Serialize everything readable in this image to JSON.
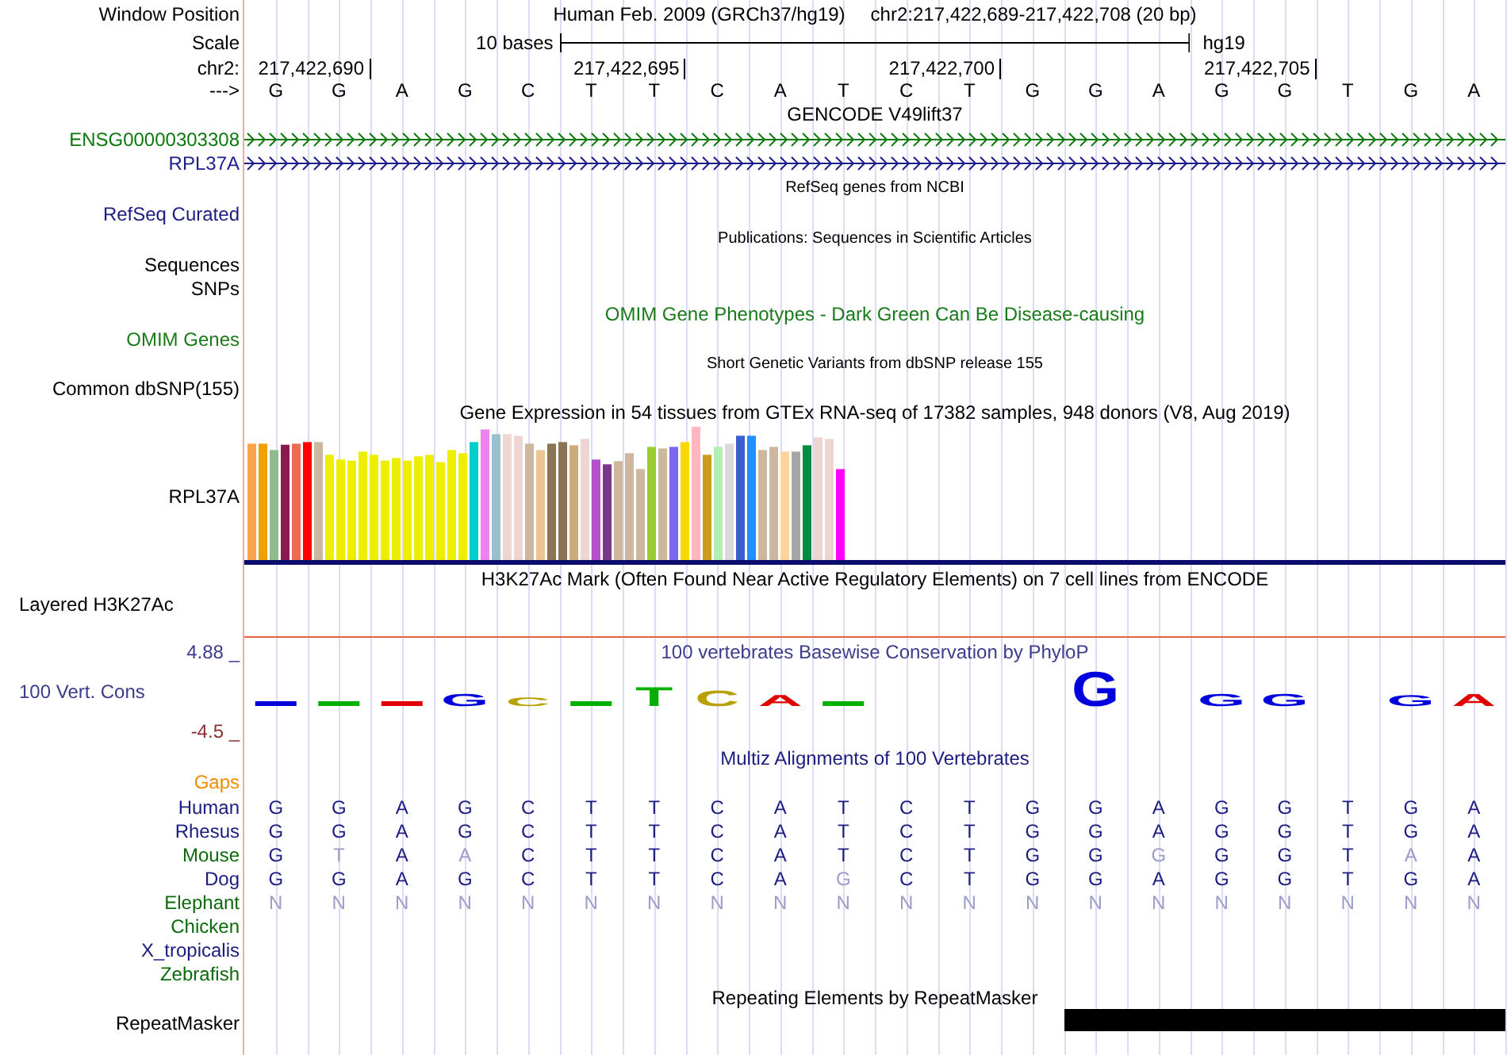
{
  "window_position": {
    "label": "Window Position",
    "assembly": "Human Feb. 2009 (GRCh37/hg19)",
    "range": "chr2:217,422,689-217,422,708 (20 bp)"
  },
  "scale": {
    "label": "Scale",
    "ruler_label": "10 bases",
    "assembly": "hg19"
  },
  "coordinates": {
    "label": "chr2:",
    "ticks": [
      "217,422,690",
      "217,422,695",
      "217,422,700",
      "217,422,705"
    ]
  },
  "sequence": {
    "label": "--->",
    "bases": [
      "G",
      "G",
      "A",
      "G",
      "C",
      "T",
      "T",
      "C",
      "A",
      "T",
      "C",
      "T",
      "G",
      "G",
      "A",
      "G",
      "G",
      "T",
      "G",
      "A"
    ]
  },
  "gencode": {
    "title": "GENCODE V49lift37",
    "genes": [
      {
        "name": "ENSG00000303308",
        "color": "#0b780b"
      },
      {
        "name": "RPL37A",
        "color": "#1c1c8c"
      }
    ]
  },
  "refseq": {
    "title": "RefSeq genes from NCBI",
    "label": "RefSeq Curated"
  },
  "publications": {
    "title": "Publications: Sequences in Scientific Articles",
    "labels": [
      "Sequences",
      "SNPs"
    ]
  },
  "omim": {
    "title": "OMIM Gene Phenotypes - Dark Green Can Be Disease-causing",
    "label": "OMIM Genes"
  },
  "dbsnp": {
    "title": "Short Genetic Variants from dbSNP release 155",
    "label": "Common dbSNP(155)"
  },
  "gtex": {
    "title": "Gene Expression in 54 tissues from GTEx RNA-seq of 17382 samples, 948 donors (V8, Aug 2019)",
    "label": "RPL37A"
  },
  "h3k27ac": {
    "title": "H3K27Ac Mark (Often Found Near Active Regulatory Elements) on 7 cell lines from ENCODE",
    "label": "Layered H3K27Ac"
  },
  "phylop": {
    "title": "100 vertebrates Basewise Conservation by PhyloP",
    "label": "100 Vert. Cons",
    "max": "4.88 _",
    "min": "-4.5 _",
    "glyphs": [
      {
        "base": "G",
        "color": "#0000dd"
      },
      {
        "base": "C",
        "color": "#b8a000"
      },
      {
        "base": "T",
        "color": "#00b000"
      },
      {
        "base": "C",
        "color": "#b8a000"
      },
      {
        "base": "A",
        "color": "#e00000"
      },
      {
        "base": "G",
        "color": "#0000dd"
      },
      {
        "base": "G",
        "color": "#0000dd"
      },
      {
        "base": "G",
        "color": "#0000dd"
      },
      {
        "base": "G",
        "color": "#0000dd"
      },
      {
        "base": "A",
        "color": "#e00000"
      }
    ]
  },
  "multiz": {
    "title": "Multiz Alignments of 100 Vertebrates",
    "gaps_label": "Gaps",
    "species": [
      {
        "name": "Human",
        "color": "#1c1c80",
        "bases": [
          {
            "base": "G",
            "faded": false
          },
          {
            "base": "G",
            "faded": false
          },
          {
            "base": "A",
            "faded": false
          },
          {
            "base": "G",
            "faded": false
          },
          {
            "base": "C",
            "faded": false
          },
          {
            "base": "T",
            "faded": false
          },
          {
            "base": "T",
            "faded": false
          },
          {
            "base": "C",
            "faded": false
          },
          {
            "base": "A",
            "faded": false
          },
          {
            "base": "T",
            "faded": false
          },
          {
            "base": "C",
            "faded": false
          },
          {
            "base": "T",
            "faded": false
          },
          {
            "base": "G",
            "faded": false
          },
          {
            "base": "G",
            "faded": false
          },
          {
            "base": "A",
            "faded": false
          },
          {
            "base": "G",
            "faded": false
          },
          {
            "base": "G",
            "faded": false
          },
          {
            "base": "T",
            "faded": false
          },
          {
            "base": "G",
            "faded": false
          },
          {
            "base": "A",
            "faded": false
          }
        ]
      },
      {
        "name": "Rhesus",
        "color": "#1c1c80",
        "bases": [
          {
            "base": "G",
            "faded": false
          },
          {
            "base": "G",
            "faded": false
          },
          {
            "base": "A",
            "faded": false
          },
          {
            "base": "G",
            "faded": false
          },
          {
            "base": "C",
            "faded": false
          },
          {
            "base": "T",
            "faded": false
          },
          {
            "base": "T",
            "faded": false
          },
          {
            "base": "C",
            "faded": false
          },
          {
            "base": "A",
            "faded": false
          },
          {
            "base": "T",
            "faded": false
          },
          {
            "base": "C",
            "faded": false
          },
          {
            "base": "T",
            "faded": false
          },
          {
            "base": "G",
            "faded": false
          },
          {
            "base": "G",
            "faded": false
          },
          {
            "base": "A",
            "faded": false
          },
          {
            "base": "G",
            "faded": false
          },
          {
            "base": "G",
            "faded": false
          },
          {
            "base": "T",
            "faded": false
          },
          {
            "base": "G",
            "faded": false
          },
          {
            "base": "A",
            "faded": false
          }
        ]
      },
      {
        "name": "Mouse",
        "color": "#0b6b0b",
        "bases": [
          {
            "base": "G",
            "faded": false
          },
          {
            "base": "T",
            "faded": true
          },
          {
            "base": "A",
            "faded": false
          },
          {
            "base": "A",
            "faded": true
          },
          {
            "base": "C",
            "faded": false
          },
          {
            "base": "T",
            "faded": false
          },
          {
            "base": "T",
            "faded": false
          },
          {
            "base": "C",
            "faded": false
          },
          {
            "base": "A",
            "faded": false
          },
          {
            "base": "T",
            "faded": false
          },
          {
            "base": "C",
            "faded": false
          },
          {
            "base": "T",
            "faded": false
          },
          {
            "base": "G",
            "faded": false
          },
          {
            "base": "G",
            "faded": false
          },
          {
            "base": "G",
            "faded": true
          },
          {
            "base": "G",
            "faded": false
          },
          {
            "base": "G",
            "faded": false
          },
          {
            "base": "T",
            "faded": false
          },
          {
            "base": "A",
            "faded": true
          },
          {
            "base": "A",
            "faded": false
          }
        ]
      },
      {
        "name": "Dog",
        "color": "#1c1c80",
        "bases": [
          {
            "base": "G",
            "faded": false
          },
          {
            "base": "G",
            "faded": false
          },
          {
            "base": "A",
            "faded": false
          },
          {
            "base": "G",
            "faded": false
          },
          {
            "base": "C",
            "faded": false
          },
          {
            "base": "T",
            "faded": false
          },
          {
            "base": "T",
            "faded": false
          },
          {
            "base": "C",
            "faded": false
          },
          {
            "base": "A",
            "faded": false
          },
          {
            "base": "G",
            "faded": true
          },
          {
            "base": "C",
            "faded": false
          },
          {
            "base": "T",
            "faded": false
          },
          {
            "base": "G",
            "faded": false
          },
          {
            "base": "G",
            "faded": false
          },
          {
            "base": "A",
            "faded": false
          },
          {
            "base": "G",
            "faded": false
          },
          {
            "base": "G",
            "faded": false
          },
          {
            "base": "T",
            "faded": false
          },
          {
            "base": "G",
            "faded": false
          },
          {
            "base": "A",
            "faded": false
          }
        ]
      },
      {
        "name": "Elephant",
        "color": "#0b6b0b",
        "bases": [
          {
            "base": "N",
            "faded": true
          },
          {
            "base": "N",
            "faded": true
          },
          {
            "base": "N",
            "faded": true
          },
          {
            "base": "N",
            "faded": true
          },
          {
            "base": "N",
            "faded": true
          },
          {
            "base": "N",
            "faded": true
          },
          {
            "base": "N",
            "faded": true
          },
          {
            "base": "N",
            "faded": true
          },
          {
            "base": "N",
            "faded": true
          },
          {
            "base": "N",
            "faded": true
          },
          {
            "base": "N",
            "faded": true
          },
          {
            "base": "N",
            "faded": true
          },
          {
            "base": "N",
            "faded": true
          },
          {
            "base": "N",
            "faded": true
          },
          {
            "base": "N",
            "faded": true
          },
          {
            "base": "N",
            "faded": true
          },
          {
            "base": "N",
            "faded": true
          },
          {
            "base": "N",
            "faded": true
          },
          {
            "base": "N",
            "faded": true
          },
          {
            "base": "N",
            "faded": true
          }
        ]
      },
      {
        "name": "Chicken",
        "color": "#0b6b0b"
      },
      {
        "name": "X_tropicalis",
        "color": "#1c1c80"
      },
      {
        "name": "Zebrafish",
        "color": "#0b6b0b"
      }
    ]
  },
  "repeatmasker": {
    "title": "Repeating Elements by RepeatMasker",
    "label": "RepeatMasker"
  }
}
